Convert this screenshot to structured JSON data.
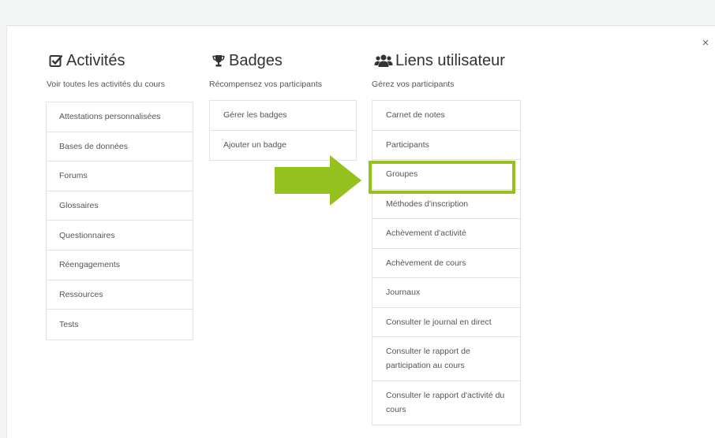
{
  "modal": {
    "close_label": "×"
  },
  "colors": {
    "accent": "#95c11f",
    "text": "#333333",
    "border": "#e3e3e3"
  },
  "activites": {
    "icon": "check-square-icon",
    "title": "Activités",
    "subtitle": "Voir toutes les activités du cours",
    "items": [
      "Attestations personnalisées",
      "Bases de données",
      "Forums",
      "Glossaires",
      "Questionnaires",
      "Réengagements",
      "Ressources",
      "Tests"
    ]
  },
  "badges": {
    "icon": "trophy-icon",
    "title": "Badges",
    "subtitle": "Récompensez vos participants",
    "items": [
      "Gérer les badges",
      "Ajouter un badge"
    ]
  },
  "liens": {
    "icon": "users-icon",
    "title": "Liens utilisateur",
    "subtitle": "Gérez vos participants",
    "items": [
      "Carnet de notes",
      "Participants",
      "Groupes",
      "Méthodes d'inscription",
      "Achèvement d'activité",
      "Achèvement de cours",
      "Journaux",
      "Consulter le journal en direct",
      "Consulter le rapport de participation au cours",
      "Consulter le rapport d'activité du cours"
    ],
    "highlighted": "Groupes"
  }
}
